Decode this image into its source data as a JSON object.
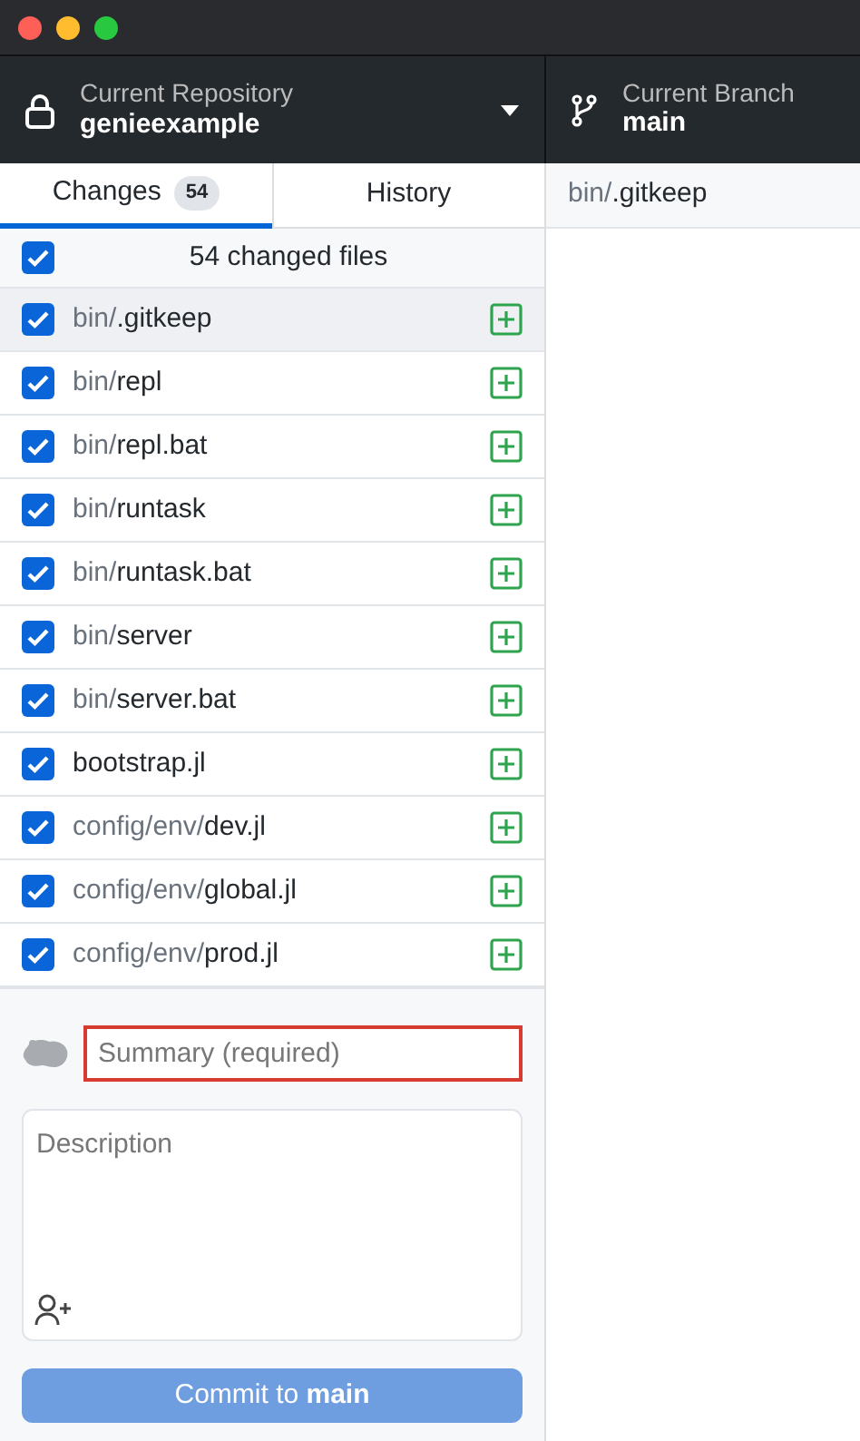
{
  "toolbar": {
    "repository": {
      "label": "Current Repository",
      "name": "genieexample"
    },
    "branch": {
      "label": "Current Branch",
      "name": "main"
    }
  },
  "tabs": [
    {
      "label": "Changes",
      "count": "54",
      "selected": true
    },
    {
      "label": "History",
      "selected": false
    }
  ],
  "changes_header": {
    "text": "54 changed files",
    "checked": true
  },
  "files": [
    {
      "dir": "bin/",
      "name": ".gitkeep",
      "checked": true,
      "selected": true
    },
    {
      "dir": "bin/",
      "name": "repl",
      "checked": true,
      "selected": false
    },
    {
      "dir": "bin/",
      "name": "repl.bat",
      "checked": true,
      "selected": false
    },
    {
      "dir": "bin/",
      "name": "runtask",
      "checked": true,
      "selected": false
    },
    {
      "dir": "bin/",
      "name": "runtask.bat",
      "checked": true,
      "selected": false
    },
    {
      "dir": "bin/",
      "name": "server",
      "checked": true,
      "selected": false
    },
    {
      "dir": "bin/",
      "name": "server.bat",
      "checked": true,
      "selected": false
    },
    {
      "name": "bootstrap.jl",
      "checked": true,
      "selected": false
    },
    {
      "dir": "config/env/",
      "name": "dev.jl",
      "checked": true,
      "selected": false
    },
    {
      "dir": "config/env/",
      "name": "global.jl",
      "checked": true,
      "selected": false
    },
    {
      "dir": "config/env/",
      "name": "prod.jl",
      "checked": true,
      "selected": false
    }
  ],
  "diff_header": {
    "dir": "bin/",
    "name": ".gitkeep"
  },
  "commit": {
    "summary": {
      "placeholder": "Summary (required)",
      "invalid": true
    },
    "description": {
      "placeholder": "Description"
    },
    "button": {
      "label": "Commit to **main**",
      "disabled": true
    }
  }
}
